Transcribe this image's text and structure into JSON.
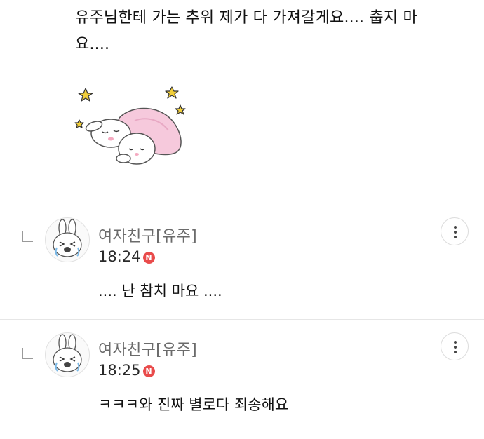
{
  "top_comment": {
    "text": "유주님한테 가는 추위 제가 다 가져갈게요.... 춥지 마요....",
    "sticker_icon": "sleeping-bunny-under-blanket-sticker"
  },
  "replies": [
    {
      "nickname": "여자친구[유주]",
      "time": "18:24",
      "new_badge": "N",
      "text": ".... 난 참치 마요 ....",
      "avatar_icon": "crying-bunny-avatar",
      "more_icon": "kebab-menu-icon"
    },
    {
      "nickname": "여자친구[유주]",
      "time": "18:25",
      "new_badge": "N",
      "text": "ㅋㅋㅋ와 진짜 별로다 죄송해요",
      "avatar_icon": "crying-bunny-avatar",
      "more_icon": "kebab-menu-icon"
    }
  ],
  "colors": {
    "new_badge": "#e94b4b",
    "nickname": "#6b6b6b",
    "divider": "#e6e6e6"
  }
}
